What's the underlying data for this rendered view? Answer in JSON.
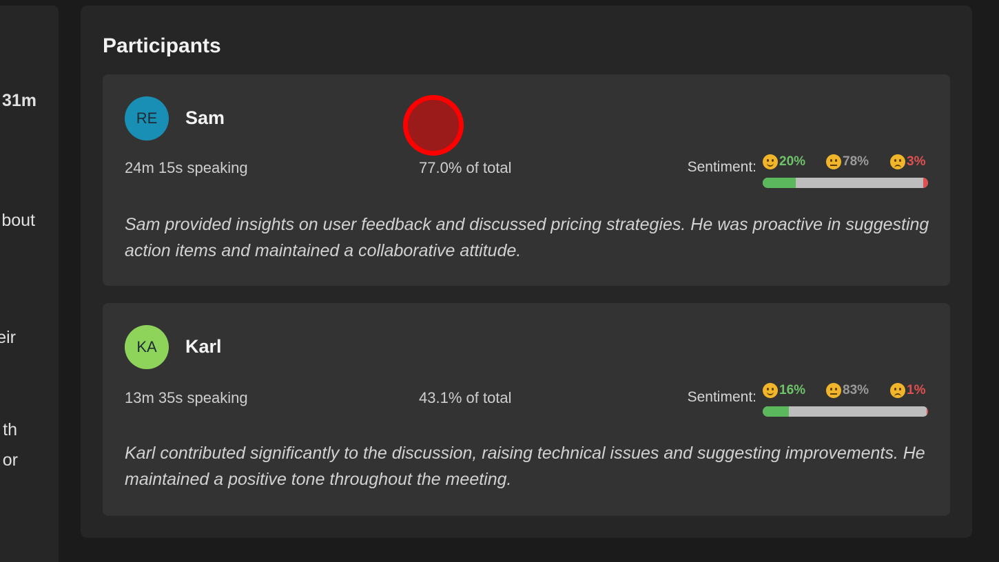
{
  "left_panel": {
    "fragments": [
      "31m",
      "bout",
      "eir",
      "th",
      "or"
    ]
  },
  "participants_section": {
    "title": "Participants",
    "participants": [
      {
        "initials": "RE",
        "avatar_color": "#1a8fb5",
        "name": "Sam",
        "speaking_time": "24m 15s speaking",
        "share_of_total": "77.0% of total",
        "sentiment_label": "Sentiment:",
        "sentiment": {
          "positive": "20%",
          "neutral": "78%",
          "negative": "3%"
        },
        "sentiment_values": {
          "positive": 20,
          "neutral": 78,
          "negative": 3
        },
        "summary": "Sam provided insights on user feedback and discussed pricing strategies. He was proactive in suggesting action items and maintained a collaborative attitude."
      },
      {
        "initials": "KA",
        "avatar_color": "#8ed45a",
        "name": "Karl",
        "speaking_time": "13m 35s speaking",
        "share_of_total": "43.1% of total",
        "sentiment_label": "Sentiment:",
        "sentiment": {
          "positive": "16%",
          "neutral": "83%",
          "negative": "1%"
        },
        "sentiment_values": {
          "positive": 16,
          "neutral": 83,
          "negative": 1
        },
        "summary": "Karl contributed significantly to the discussion, raising technical issues and suggesting improvements. He maintained a positive tone throughout the meeting."
      }
    ]
  },
  "colors": {
    "positive": "#6fc46a",
    "neutral": "#9a9a9a",
    "negative": "#e05050",
    "click_marker": "#ff0000"
  },
  "icons": {
    "positive": "smiling-face-icon",
    "neutral": "neutral-face-icon",
    "negative": "disappointed-face-icon"
  }
}
